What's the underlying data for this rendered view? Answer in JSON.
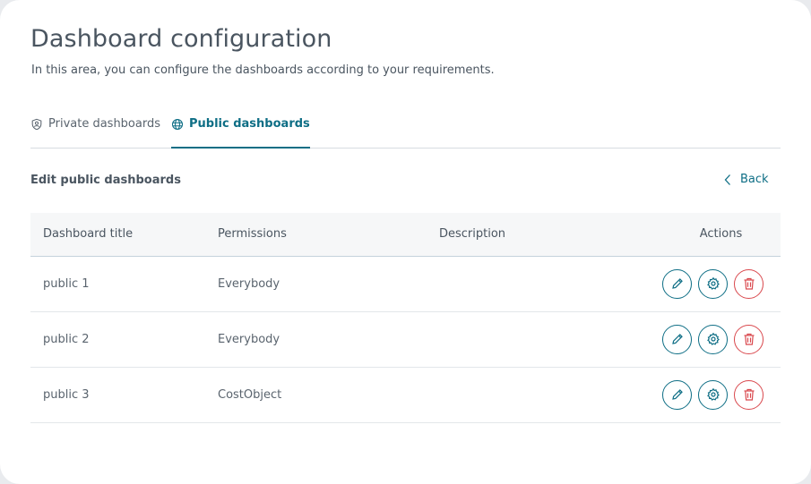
{
  "page": {
    "title": "Dashboard configuration",
    "subtitle": "In this area, you can configure the dashboards according to your requirements."
  },
  "tabs": [
    {
      "label": "Private dashboards",
      "icon": "shield-user-icon",
      "active": false
    },
    {
      "label": "Public dashboards",
      "icon": "globe-icon",
      "active": true
    }
  ],
  "section": {
    "title": "Edit public dashboards",
    "back_label": "Back"
  },
  "table": {
    "headers": [
      "Dashboard title",
      "Permissions",
      "Description",
      "Actions"
    ],
    "rows": [
      {
        "title": "public 1",
        "permissions": "Everybody",
        "description": ""
      },
      {
        "title": "public 2",
        "permissions": "Everybody",
        "description": ""
      },
      {
        "title": "public 3",
        "permissions": "CostObject",
        "description": ""
      }
    ],
    "row_actions": [
      "pencil-icon",
      "gear-icon",
      "trash-icon"
    ]
  },
  "colors": {
    "accent": "#0e6e85",
    "danger": "#d9484d",
    "text": "#4a5560"
  }
}
